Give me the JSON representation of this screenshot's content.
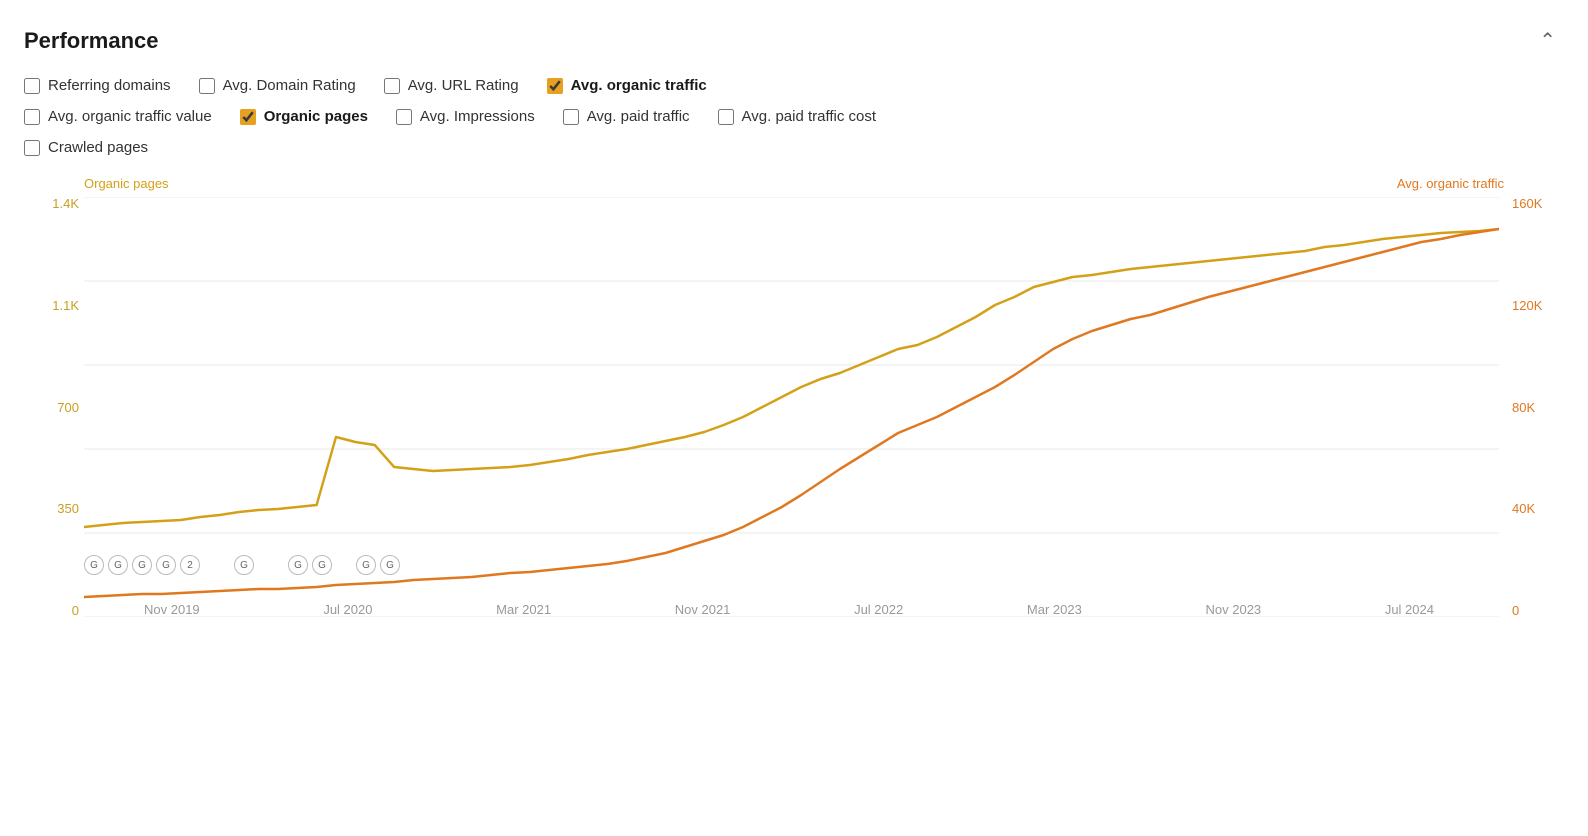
{
  "header": {
    "title": "Performance",
    "collapse_icon": "chevron-up"
  },
  "checkboxes": {
    "row1": [
      {
        "id": "referring-domains",
        "label": "Referring domains",
        "checked": false,
        "bold": false
      },
      {
        "id": "avg-domain-rating",
        "label": "Avg. Domain Rating",
        "checked": false,
        "bold": false
      },
      {
        "id": "avg-url-rating",
        "label": "Avg. URL Rating",
        "checked": false,
        "bold": false
      },
      {
        "id": "avg-organic-traffic",
        "label": "Avg. organic traffic",
        "checked": true,
        "bold": true
      }
    ],
    "row2": [
      {
        "id": "avg-organic-traffic-value",
        "label": "Avg. organic traffic value",
        "checked": false,
        "bold": false
      },
      {
        "id": "organic-pages",
        "label": "Organic pages",
        "checked": true,
        "bold": true
      },
      {
        "id": "avg-impressions",
        "label": "Avg. Impressions",
        "checked": false,
        "bold": false
      },
      {
        "id": "avg-paid-traffic",
        "label": "Avg. paid traffic",
        "checked": false,
        "bold": false
      },
      {
        "id": "avg-paid-traffic-cost",
        "label": "Avg. paid traffic cost",
        "checked": false,
        "bold": false
      }
    ],
    "row3": [
      {
        "id": "crawled-pages",
        "label": "Crawled pages",
        "checked": false,
        "bold": false
      }
    ]
  },
  "chart": {
    "left_axis_label": "Organic pages",
    "right_axis_label": "Avg. organic traffic",
    "y_left_ticks": [
      "1.4K",
      "1.1K",
      "700",
      "350",
      "0"
    ],
    "y_right_ticks": [
      "160K",
      "120K",
      "80K",
      "40K",
      "0"
    ],
    "x_ticks": [
      "Nov 2019",
      "Jul 2020",
      "Mar 2021",
      "Nov 2021",
      "Jul 2022",
      "Mar 2023",
      "Nov 2023",
      "Jul 2024"
    ],
    "line_organic_pages_color": "#d4a017",
    "line_avg_traffic_color": "#e07820",
    "accent_checked_color": "#e8a020"
  }
}
